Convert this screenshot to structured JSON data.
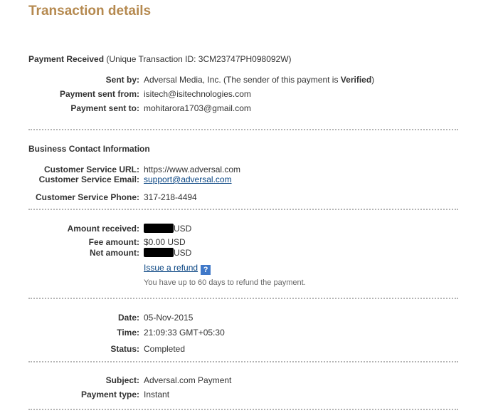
{
  "page_title": "Transaction details",
  "payment": {
    "heading": "Payment Received",
    "id_text": "(Unique Transaction ID: 3CM23747PH098092W)",
    "sent_by_label": "Sent by:",
    "sent_by_value": "Adversal Media, Inc. (The sender of this payment is ",
    "sent_by_status": "Verified",
    "sent_by_end": ")",
    "sent_from_label": "Payment sent from:",
    "sent_from_value": "isitech@isitechnologies.com",
    "sent_to_label": "Payment sent to:",
    "sent_to_value": "mohitarora1703@gmail.com"
  },
  "business": {
    "heading": "Business Contact Information",
    "url_label": "Customer Service URL:",
    "url_value": "https://www.adversal.com",
    "email_label": "Customer Service Email:",
    "email_value": "support@adversal.com",
    "phone_label": "Customer Service Phone:",
    "phone_value": "317-218-4494"
  },
  "amounts": {
    "received_label": "Amount received:",
    "received_currency": "USD",
    "fee_label": "Fee amount:",
    "fee_value": "$0.00 USD",
    "net_label": "Net amount:",
    "net_currency": "USD",
    "refund_link": "Issue a refund",
    "help_icon": "?",
    "refund_note": "You have up to 60 days to refund the payment."
  },
  "details": {
    "date_label": "Date:",
    "date_value": "05-Nov-2015",
    "time_label": "Time:",
    "time_value": "21:09:33 GMT+05:30",
    "status_label": "Status:",
    "status_value": "Completed"
  },
  "subject": {
    "subject_label": "Subject:",
    "subject_value": "Adversal.com Payment",
    "type_label": "Payment type:",
    "type_value": "Instant"
  },
  "colors": {
    "title": "#b5894f",
    "link": "#084482",
    "help_icon_bg": "#3f78c8",
    "divider": "#b4b4b4"
  }
}
